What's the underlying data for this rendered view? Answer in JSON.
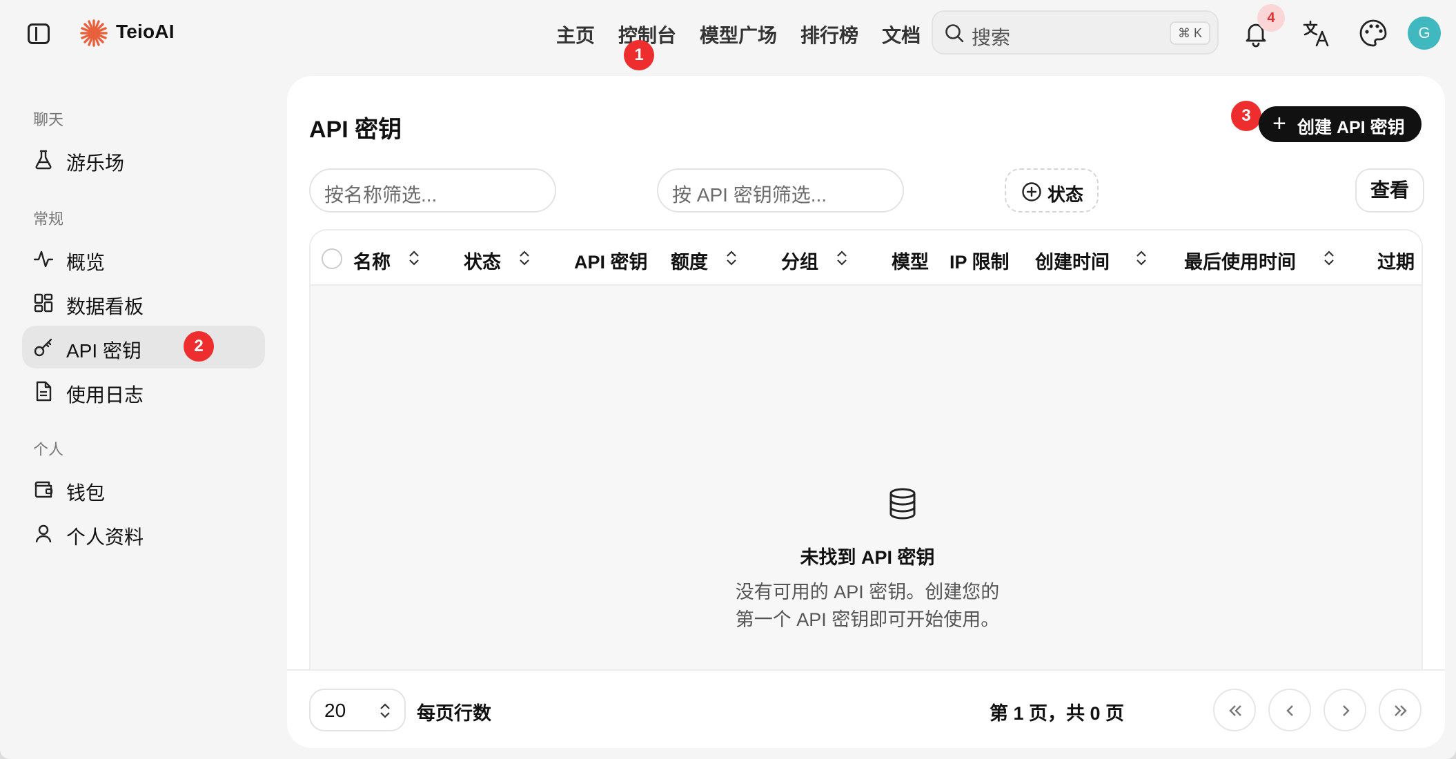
{
  "app": {
    "brand": "TeioAI"
  },
  "topnav": [
    "主页",
    "控制台",
    "模型广场",
    "排行榜",
    "文档"
  ],
  "search": {
    "placeholder": "搜索",
    "shortcut": "⌘ K"
  },
  "notifications": {
    "count": "4"
  },
  "avatar": {
    "initial": "G",
    "color": "#40b8bf"
  },
  "markers": [
    "1",
    "2",
    "3"
  ],
  "sidebar": {
    "sections": {
      "chat": "聊天",
      "general": "常规",
      "personal": "个人"
    },
    "items": {
      "playground": "游乐场",
      "overview": "概览",
      "dashboard": "数据看板",
      "api_keys": "API 密钥",
      "usage_logs": "使用日志",
      "wallet": "钱包",
      "profile": "个人资料"
    }
  },
  "main": {
    "title": "API 密钥",
    "create_label": "创建 API 密钥",
    "filter_name_placeholder": "按名称筛选...",
    "filter_key_placeholder": "按 API 密钥筛选...",
    "status_filter": "状态",
    "view_label": "查看",
    "columns": [
      "名称",
      "状态",
      "API 密钥",
      "额度",
      "分组",
      "模型",
      "IP 限制",
      "创建时间",
      "最后使用时间",
      "过期"
    ],
    "empty_title": "未找到 API 密钥",
    "empty_desc_1": "没有可用的 API 密钥。创建您的",
    "empty_desc_2": "第一个 API 密钥即可开始使用。"
  },
  "footer": {
    "rows_value": "20",
    "rows_label": "每页行数",
    "page_info": "第 1 页，共 0 页"
  }
}
